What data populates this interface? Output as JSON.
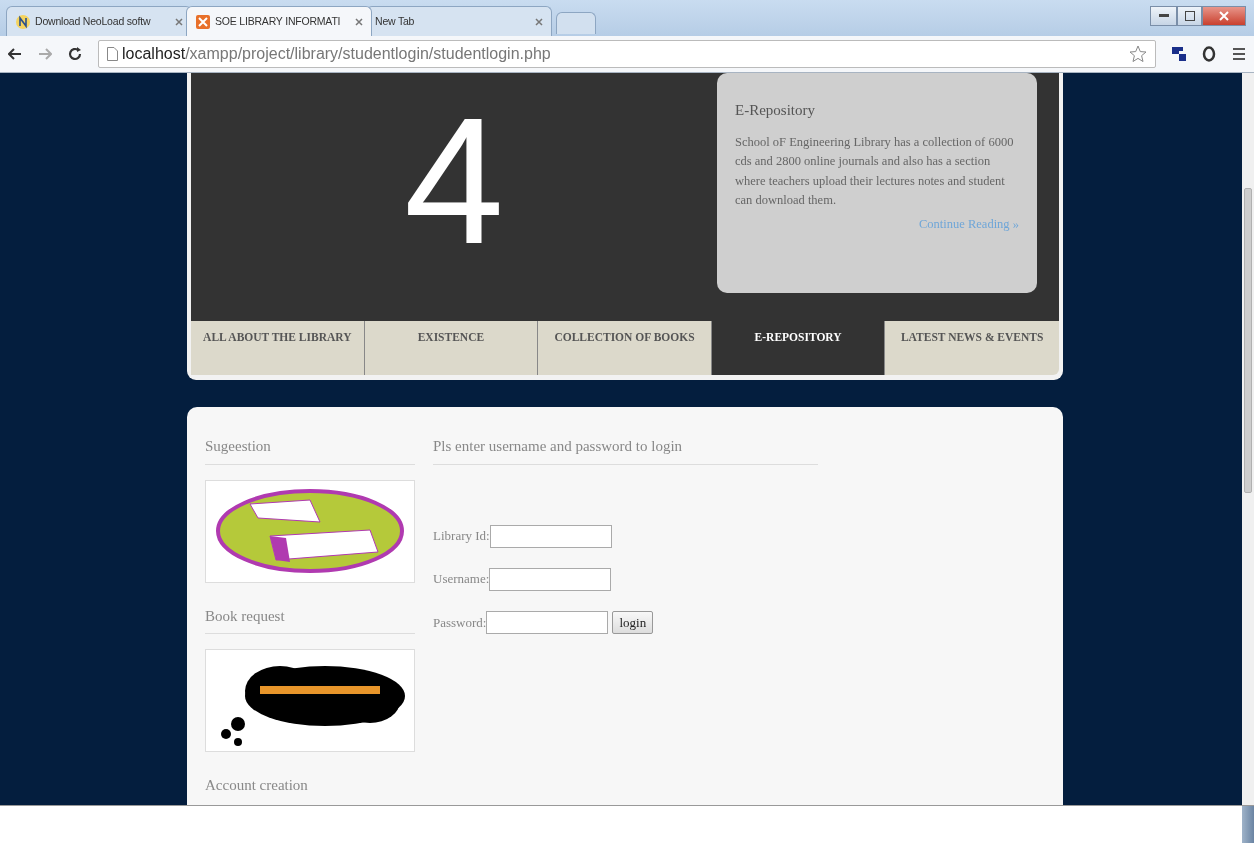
{
  "browser": {
    "tabs": [
      {
        "title": "Download NeoLoad softw",
        "kind": "site",
        "selected": false
      },
      {
        "title": "SOE LIBRARY INFORMATI",
        "kind": "local",
        "selected": true
      },
      {
        "title": "New Tab",
        "kind": "blank",
        "selected": false
      }
    ],
    "address": {
      "host": "localhost",
      "path": "/xampp/project/library/studentlogin/studentlogin.php"
    }
  },
  "slider": {
    "number": "4",
    "feature": {
      "title": "E-Repository",
      "body": "School oF Engineering Library has a collection of 6000 cds and 2800 online journals and also has a section where teachers upload their lectures notes and student can download them.",
      "link": "Continue Reading »"
    }
  },
  "nav": [
    {
      "label": "ALL ABOUT THE LIBRARY",
      "selected": false
    },
    {
      "label": "EXISTENCE",
      "selected": false
    },
    {
      "label": "COLLECTION OF BOOKS",
      "selected": false
    },
    {
      "label": "E-REPOSITORY",
      "selected": true
    },
    {
      "label": "LATEST NEWS & EVENTS",
      "selected": false
    }
  ],
  "sidebar": [
    {
      "heading": "Sugeestion",
      "kind": "suggestion"
    },
    {
      "heading": "Book request",
      "kind": "request"
    },
    {
      "heading": "Account creation",
      "kind": "plain"
    }
  ],
  "login": {
    "heading": "Pls enter username and password to login",
    "fields": [
      {
        "label": "Library Id:"
      },
      {
        "label": "Username:"
      },
      {
        "label": "Password:"
      }
    ],
    "button": "login"
  }
}
